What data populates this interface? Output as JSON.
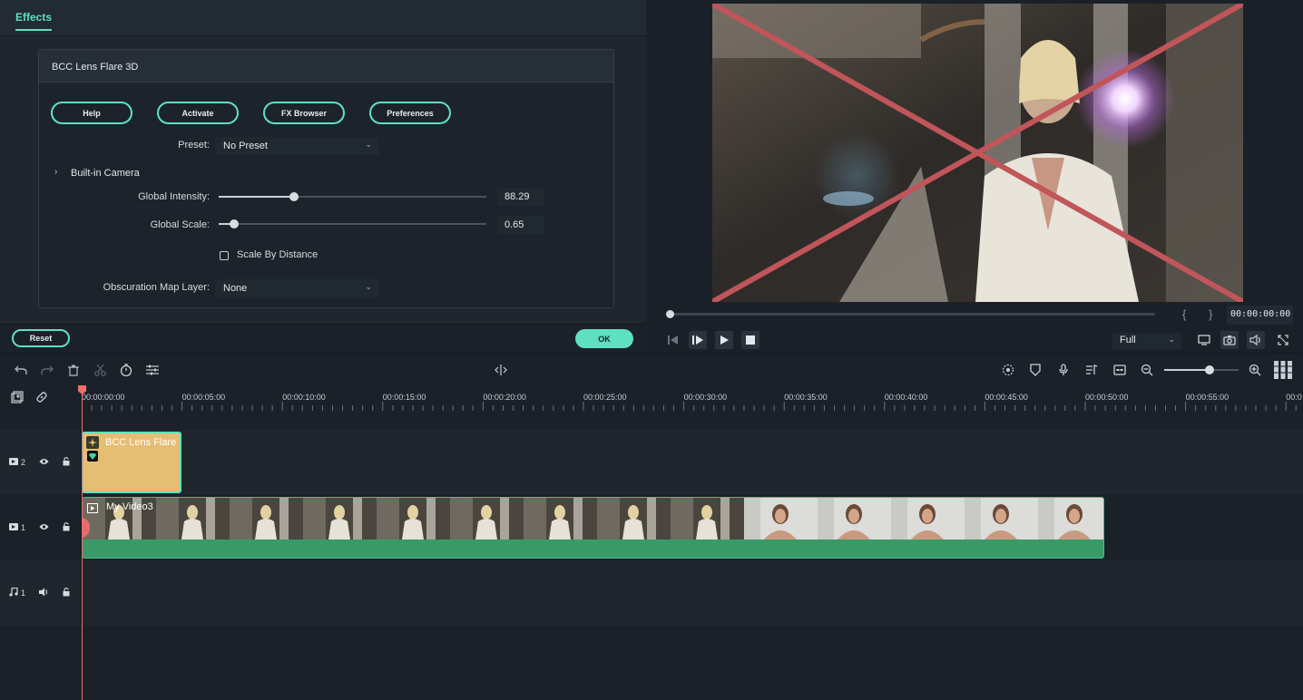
{
  "effects_panel": {
    "tab": "Effects",
    "plugin_title": "BCC Lens Flare 3D",
    "buttons": [
      "Help",
      "Activate",
      "FX Browser",
      "Preferences"
    ],
    "preset": {
      "label": "Preset:",
      "value": "No Preset"
    },
    "section": {
      "label": "Built-in Camera",
      "expanded": false
    },
    "global_intensity": {
      "label": "Global Intensity:",
      "value": "88.29",
      "fraction": 0.28
    },
    "global_scale": {
      "label": "Global Scale:",
      "value": "0.65",
      "fraction": 0.06
    },
    "scale_by_distance": {
      "label": "Scale By Distance",
      "checked": false
    },
    "obscuration": {
      "label": "Obscuration Map Layer:",
      "value": "None"
    },
    "reset_label": "Reset",
    "ok_label": "OK",
    "accent_color": "#5fe0c0"
  },
  "preview": {
    "brace_in": "{",
    "brace_out": "}",
    "timecode": "00:00:00:00",
    "quality": "Full",
    "progress": 0.0,
    "overlay_color": "#c0555a"
  },
  "timeline": {
    "ruler_ticks": [
      "00:00:00:00",
      "00:00:05:00",
      "00:00:10:00",
      "00:00:15:00",
      "00:00:20:00",
      "00:00:25:00",
      "00:00:30:00",
      "00:00:35:00",
      "00:00:40:00",
      "00:00:45:00",
      "00:00:50:00",
      "00:00:55:00",
      "00:0"
    ],
    "tracks": [
      {
        "label": "2",
        "kind": "video"
      },
      {
        "label": "1",
        "kind": "video"
      },
      {
        "label": "1",
        "kind": "audio"
      }
    ],
    "effect_clip": {
      "label": "BCC Lens Flare"
    },
    "video_clip": {
      "label": "My Video3"
    },
    "zoom_fraction": 0.6
  }
}
